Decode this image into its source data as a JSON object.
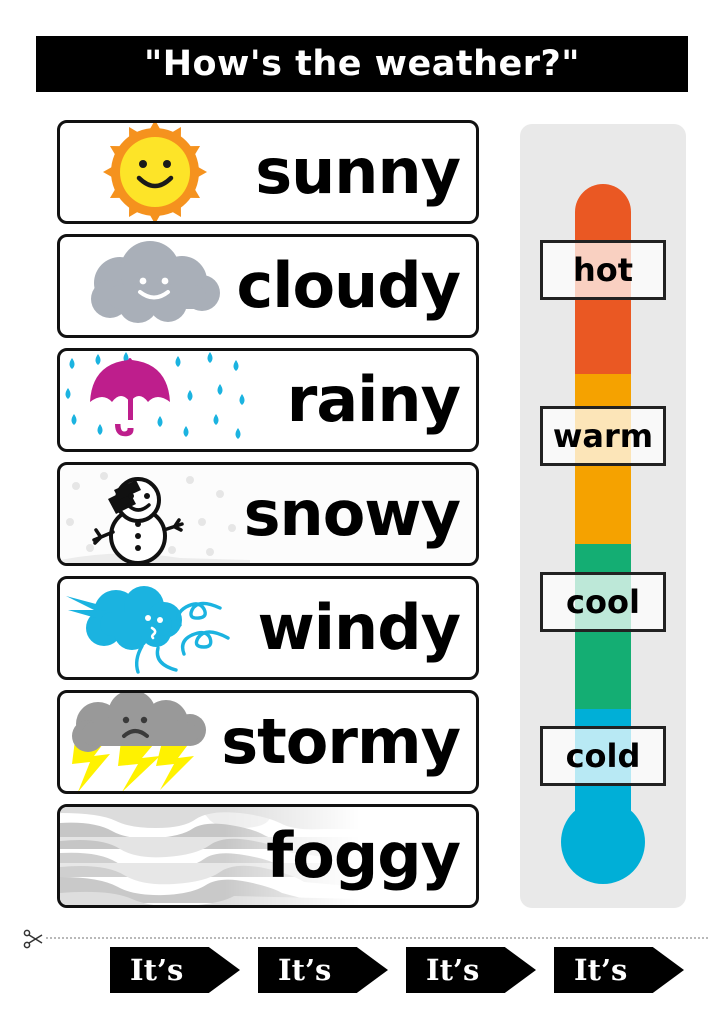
{
  "title": "\"How's the weather?\"",
  "weather_cards": [
    {
      "label": "sunny",
      "icon": "sun-icon",
      "icon_colors": {
        "body": "#FDE428",
        "rays": "#F5921E",
        "face": "#1A1A1A"
      }
    },
    {
      "label": "cloudy",
      "icon": "cloud-icon",
      "icon_colors": {
        "body": "#A9AFB8",
        "face": "#FFFFFF"
      }
    },
    {
      "label": "rainy",
      "icon": "umbrella-rain-icon",
      "icon_colors": {
        "umbrella": "#BE1E8C",
        "drops": "#1BB3E0"
      }
    },
    {
      "label": "snowy",
      "icon": "snowman-icon",
      "icon_colors": {
        "body": "#FFFFFF",
        "outline": "#111111",
        "hat": "#111111",
        "flakes": "#E6E6E6"
      }
    },
    {
      "label": "windy",
      "icon": "windy-cloud-icon",
      "icon_colors": {
        "cloud": "#1BB3E0",
        "swirls": "#1BB3E0"
      }
    },
    {
      "label": "stormy",
      "icon": "storm-cloud-icon",
      "icon_colors": {
        "cloud": "#999999",
        "lightning": "#FFF200",
        "face": "#3A3A3A"
      }
    },
    {
      "label": "foggy",
      "icon": "fog-icon",
      "icon_colors": {
        "band_dark": "#C6C6C6",
        "band_mid": "#D8D8D8",
        "band_light": "#EDEDED"
      }
    }
  ],
  "thermometer": {
    "panel_color": "#E9E9E9",
    "bulb_color": "#00AFD7",
    "segments": [
      {
        "name": "hot",
        "color": "#EA5823"
      },
      {
        "name": "warm",
        "color": "#F5A200"
      },
      {
        "name": "cool",
        "color": "#14AE73"
      },
      {
        "name": "cold",
        "color": "#00AFD7"
      }
    ],
    "labels": [
      {
        "text": "hot"
      },
      {
        "text": "warm"
      },
      {
        "text": "cool"
      },
      {
        "text": "cold"
      }
    ]
  },
  "cut_section": {
    "scissors_icon": "scissors-icon",
    "strips": [
      {
        "text": "It’s"
      },
      {
        "text": "It’s"
      },
      {
        "text": "It’s"
      },
      {
        "text": "It’s"
      }
    ]
  }
}
